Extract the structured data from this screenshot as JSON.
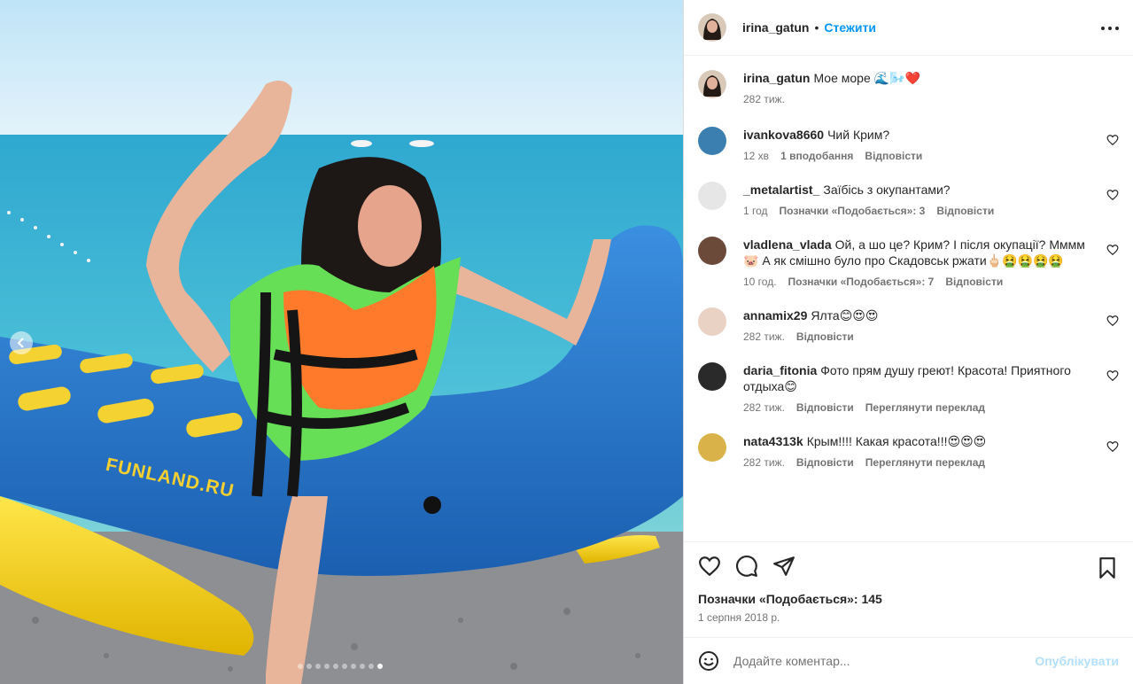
{
  "media": {
    "watermark": "FUNLAND.RU",
    "slides_count": 10,
    "active_slide": 9
  },
  "header": {
    "username": "irina_gatun",
    "separator": "•",
    "follow_label": "Стежити"
  },
  "caption": {
    "username": "irina_gatun",
    "text": "Мое море 🌊🌬️❤️",
    "time": "282 тиж."
  },
  "comments": [
    {
      "username": "ivankova8660",
      "text": "Чий Крим?",
      "time": "12 хв",
      "likes": "1 вподобання",
      "reply": "Відповісти",
      "translate": "",
      "avatar_color": "#3a7fb0"
    },
    {
      "username": "_metalartist_",
      "text": "Заїбісь з окупантами?",
      "time": "1 год",
      "likes": "Позначки «Подобається»: 3",
      "reply": "Відповісти",
      "translate": "",
      "avatar_color": "#e6e6e6"
    },
    {
      "username": "vladlena_vlada",
      "text": "Ой, а шо це? Крим? І після окупації? Мммм🐷 А як смішно було про Скадовськ ржати🖕🏻🤮🤮🤮🤮",
      "time": "10 год.",
      "likes": "Позначки «Подобається»: 7",
      "reply": "Відповісти",
      "translate": "",
      "avatar_color": "#6b4a3a"
    },
    {
      "username": "annamix29",
      "text": "Ялта😊😍😍",
      "time": "282 тиж.",
      "likes": "",
      "reply": "Відповісти",
      "translate": "",
      "avatar_color": "#e9d2c4"
    },
    {
      "username": "daria_fitonia",
      "text": "Фото прям душу греют! Красота! Приятного отдыха😊",
      "time": "282 тиж.",
      "likes": "",
      "reply": "Відповісти",
      "translate": "Переглянути переклад",
      "avatar_color": "#2a2a2a"
    },
    {
      "username": "nata4313k",
      "text": "Крым!!!! Какая красота!!!😍😍😍",
      "time": "282 тиж.",
      "likes": "",
      "reply": "Відповісти",
      "translate": "Переглянути переклад",
      "avatar_color": "#d9b34a"
    }
  ],
  "actions": {
    "likes_text": "Позначки «Подобається»: 145",
    "date": "1 серпня 2018 р."
  },
  "add_comment": {
    "placeholder": "Додайте коментар...",
    "publish_label": "Опублікувати"
  }
}
